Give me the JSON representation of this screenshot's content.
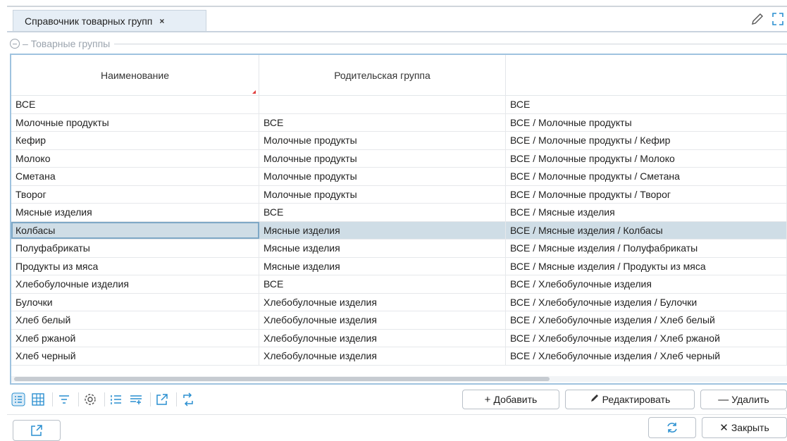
{
  "tab": {
    "title": "Справочник товарных групп",
    "close": "×"
  },
  "section": {
    "title": "Товарные группы"
  },
  "table": {
    "columns": [
      "Наименование",
      "Родительская группа",
      ""
    ],
    "rows": [
      [
        "ВСЕ",
        "",
        "ВСЕ"
      ],
      [
        "Молочные продукты",
        "ВСЕ",
        "ВСЕ / Молочные продукты"
      ],
      [
        "Кефир",
        "Молочные продукты",
        "ВСЕ / Молочные продукты / Кефир"
      ],
      [
        "Молоко",
        "Молочные продукты",
        "ВСЕ / Молочные продукты / Молоко"
      ],
      [
        "Сметана",
        "Молочные продукты",
        "ВСЕ / Молочные продукты / Сметана"
      ],
      [
        "Творог",
        "Молочные продукты",
        "ВСЕ / Молочные продукты / Творог"
      ],
      [
        "Мясные изделия",
        "ВСЕ",
        "ВСЕ / Мясные изделия"
      ],
      [
        "Колбасы",
        "Мясные изделия",
        "ВСЕ / Мясные изделия / Колбасы"
      ],
      [
        "Полуфабрикаты",
        "Мясные изделия",
        "ВСЕ / Мясные изделия / Полуфабрикаты"
      ],
      [
        "Продукты из мяса",
        "Мясные изделия",
        "ВСЕ / Мясные изделия / Продукты из мяса"
      ],
      [
        "Хлебобулочные изделия",
        "ВСЕ",
        "ВСЕ / Хлебобулочные изделия"
      ],
      [
        "Булочки",
        "Хлебобулочные изделия",
        "ВСЕ / Хлебобулочные изделия / Булочки"
      ],
      [
        "Хлеб белый",
        "Хлебобулочные изделия",
        "ВСЕ / Хлебобулочные изделия / Хлеб белый"
      ],
      [
        "Хлеб ржаной",
        "Хлебобулочные изделия",
        "ВСЕ / Хлебобулочные изделия / Хлеб ржаной"
      ],
      [
        "Хлеб черный",
        "Хлебобулочные изделия",
        "ВСЕ / Хлебобулочные изделия / Хлеб черный"
      ]
    ],
    "selected_index": 7
  },
  "toolbar": {
    "add": "Добавить",
    "edit": "Редактировать",
    "delete": "Удалить",
    "icons": [
      "list-view-icon",
      "table-view-icon",
      "filter-icon",
      "settings-icon",
      "numbered-list-icon",
      "add-rows-icon",
      "open-external-icon",
      "swap-icon"
    ]
  },
  "footer": {
    "close": "Закрыть"
  },
  "colors": {
    "accent": "#2a8fd0",
    "selected_row": "#cfdde6",
    "grid_border": "#9fc3df",
    "tab_bg": "#e6eef6"
  }
}
